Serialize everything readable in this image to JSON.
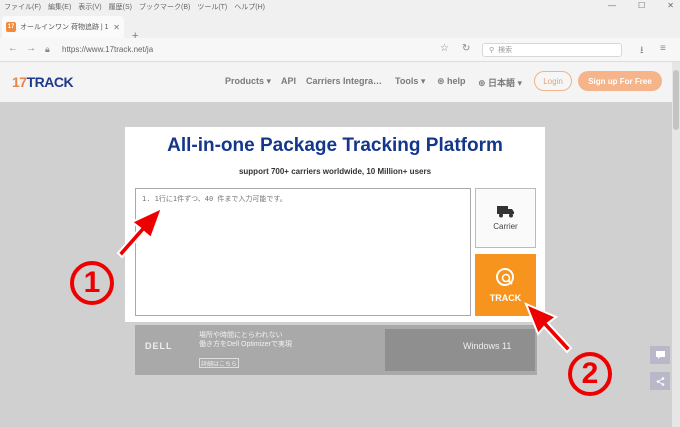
{
  "browser": {
    "menu": [
      "ファイル(F)",
      "編集(E)",
      "表示(V)",
      "履歴(S)",
      "ブックマーク(B)",
      "ツール(T)",
      "ヘルプ(H)"
    ],
    "tab_title": "オールインワン 荷物追跡 | 17TRA…",
    "tab_favicon": "17",
    "url": "https://www.17track.net/ja",
    "search_placeholder": "検索"
  },
  "site": {
    "logo_prefix": "17",
    "logo_suffix": "TRACK",
    "nav": {
      "products": "Products ▾",
      "api": "API",
      "carriers": "Carriers Integra…",
      "tools": "Tools ▾",
      "help": "help",
      "language": "日本語 ▾"
    },
    "login": "Login",
    "signup": "Sign up For Free"
  },
  "tracker": {
    "title": "All-in-one Package Tracking Platform",
    "subtitle": "support 700+ carriers worldwide, 10 Million+ users",
    "input_placeholder": "1. 1行に1件ずつ、40 件まで入力可能です。",
    "carrier_label": "Carrier",
    "track_label": "TRACK"
  },
  "ad": {
    "brand": "DELL",
    "line1": "場所や時間にとらわれない",
    "line2": "働き方をDell Optimizerで実現",
    "detail": "詳細はこちら",
    "os": "Windows 11"
  },
  "annotations": {
    "one": "1",
    "two": "2"
  },
  "colors": {
    "accent": "#f7941d",
    "title": "#14378c",
    "annotation": "#e00000"
  }
}
